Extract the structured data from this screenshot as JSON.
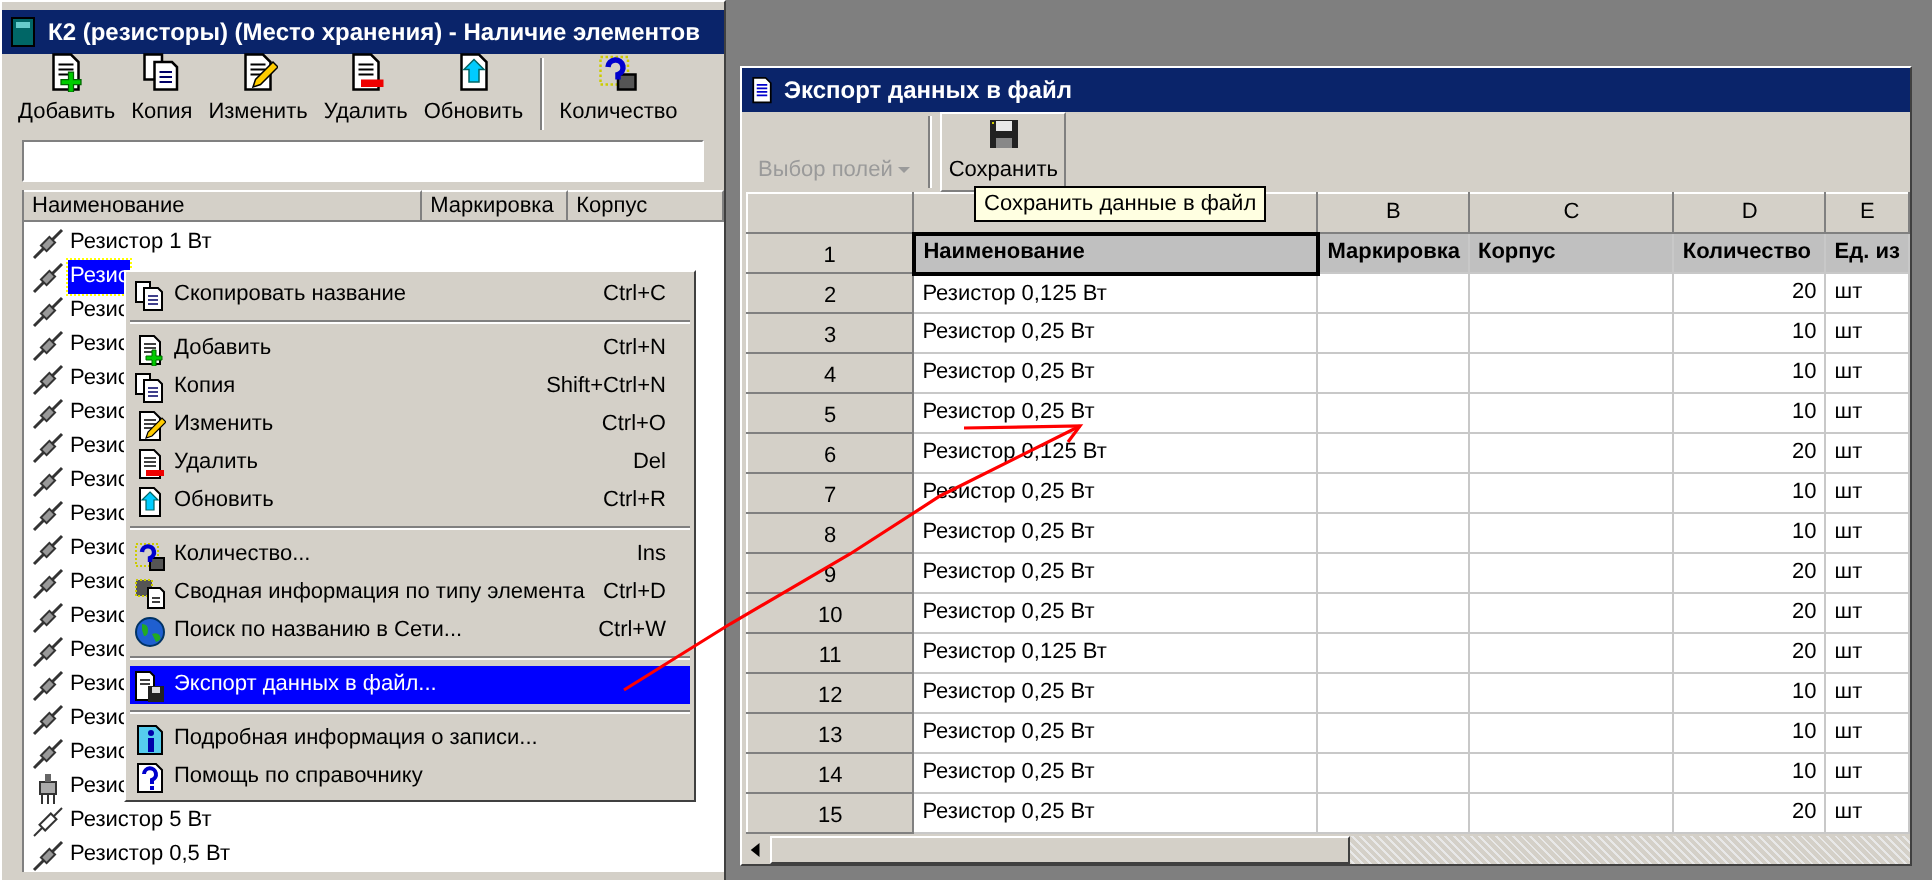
{
  "main_window": {
    "title": "К2 (резисторы) (Место хранения) - Наличие элементов",
    "toolbar": [
      {
        "label": "Добавить"
      },
      {
        "label": "Копия"
      },
      {
        "label": "Изменить"
      },
      {
        "label": "Удалить"
      },
      {
        "label": "Обновить"
      },
      {
        "label": "Количество"
      }
    ],
    "columns": [
      "Наименование",
      "Маркировка",
      "Корпус"
    ],
    "items": [
      {
        "name": "Резистор 1 Вт",
        "selected": false,
        "kind": "fixed"
      },
      {
        "name": "Резис",
        "selected": true,
        "kind": "fixed"
      },
      {
        "name": "Резис",
        "selected": false,
        "kind": "fixed"
      },
      {
        "name": "Резис",
        "selected": false,
        "kind": "fixed"
      },
      {
        "name": "Резис",
        "selected": false,
        "kind": "fixed"
      },
      {
        "name": "Резис",
        "selected": false,
        "kind": "fixed"
      },
      {
        "name": "Резис",
        "selected": false,
        "kind": "fixed"
      },
      {
        "name": "Резис",
        "selected": false,
        "kind": "fixed"
      },
      {
        "name": "Резис",
        "selected": false,
        "kind": "fixed"
      },
      {
        "name": "Резис",
        "selected": false,
        "kind": "fixed"
      },
      {
        "name": "Резис",
        "selected": false,
        "kind": "fixed"
      },
      {
        "name": "Резис",
        "selected": false,
        "kind": "fixed"
      },
      {
        "name": "Резис",
        "selected": false,
        "kind": "fixed"
      },
      {
        "name": "Резис",
        "selected": false,
        "kind": "fixed"
      },
      {
        "name": "Резис",
        "selected": false,
        "kind": "fixed"
      },
      {
        "name": "Резис",
        "selected": false,
        "kind": "fixed"
      },
      {
        "name": "Резис",
        "selected": false,
        "kind": "variable"
      },
      {
        "name": "Резистор 5 Вт",
        "selected": false,
        "kind": "outline"
      },
      {
        "name": "Резистор 0,5 Вт",
        "selected": false,
        "kind": "fixed"
      }
    ]
  },
  "context_menu": {
    "groups": [
      [
        {
          "label": "Скопировать название",
          "shortcut": "Ctrl+C",
          "selected": false
        }
      ],
      [
        {
          "label": "Добавить",
          "shortcut": "Ctrl+N",
          "selected": false
        },
        {
          "label": "Копия",
          "shortcut": "Shift+Ctrl+N",
          "selected": false
        },
        {
          "label": "Изменить",
          "shortcut": "Ctrl+O",
          "selected": false
        },
        {
          "label": "Удалить",
          "shortcut": "Del",
          "selected": false
        },
        {
          "label": "Обновить",
          "shortcut": "Ctrl+R",
          "selected": false
        }
      ],
      [
        {
          "label": "Количество...",
          "shortcut": "Ins",
          "selected": false
        },
        {
          "label": "Сводная информация по типу элемента",
          "shortcut": "Ctrl+D",
          "selected": false
        },
        {
          "label": "Поиск по названию в Сети...",
          "shortcut": "Ctrl+W",
          "selected": false
        }
      ],
      [
        {
          "label": "Экспорт данных в файл...",
          "selected": true
        }
      ],
      [
        {
          "label": "Подробная информация о записи...",
          "selected": false
        },
        {
          "label": "Помощь по справочнику",
          "selected": false
        }
      ]
    ]
  },
  "export_window": {
    "title": "Экспорт данных в файл",
    "field_picker": {
      "label": "Выбор полей",
      "disabled": true
    },
    "save_button": {
      "label": "Сохранить"
    },
    "tooltip": "Сохранить данные в файл",
    "column_letters": [
      "B",
      "C",
      "D",
      "E"
    ],
    "rows": [
      {
        "number": "1",
        "kind": "header",
        "cells": [
          "Наименование",
          "Маркировка",
          "Корпус",
          "Количество",
          "Ед. из"
        ]
      },
      {
        "number": "2",
        "kind": "data",
        "cells": [
          "Резистор 0,125 Вт",
          "",
          "",
          "20",
          "шт"
        ]
      },
      {
        "number": "3",
        "kind": "data",
        "cells": [
          "Резистор 0,25 Вт",
          "",
          "",
          "10",
          "шт"
        ]
      },
      {
        "number": "4",
        "kind": "data",
        "cells": [
          "Резистор 0,25 Вт",
          "",
          "",
          "10",
          "шт"
        ]
      },
      {
        "number": "5",
        "kind": "data",
        "cells": [
          "Резистор 0,25 Вт",
          "",
          "",
          "10",
          "шт"
        ]
      },
      {
        "number": "6",
        "kind": "data",
        "cells": [
          "Резистор 0,125 Вт",
          "",
          "",
          "20",
          "шт"
        ]
      },
      {
        "number": "7",
        "kind": "data",
        "cells": [
          "Резистор 0,25 Вт",
          "",
          "",
          "10",
          "шт"
        ]
      },
      {
        "number": "8",
        "kind": "data",
        "cells": [
          "Резистор 0,25 Вт",
          "",
          "",
          "10",
          "шт"
        ]
      },
      {
        "number": "9",
        "kind": "data",
        "cells": [
          "Резистор 0,25 Вт",
          "",
          "",
          "20",
          "шт"
        ]
      },
      {
        "number": "10",
        "kind": "data",
        "cells": [
          "Резистор 0,25 Вт",
          "",
          "",
          "20",
          "шт"
        ]
      },
      {
        "number": "11",
        "kind": "data",
        "cells": [
          "Резистор 0,125 Вт",
          "",
          "",
          "20",
          "шт"
        ]
      },
      {
        "number": "12",
        "kind": "data",
        "cells": [
          "Резистор 0,25 Вт",
          "",
          "",
          "10",
          "шт"
        ]
      },
      {
        "number": "13",
        "kind": "data",
        "cells": [
          "Резистор 0,25 Вт",
          "",
          "",
          "10",
          "шт"
        ]
      },
      {
        "number": "14",
        "kind": "data",
        "cells": [
          "Резистор 0,25 Вт",
          "",
          "",
          "10",
          "шт"
        ]
      },
      {
        "number": "15",
        "kind": "data",
        "cells": [
          "Резистор 0,25 Вт",
          "",
          "",
          "20",
          "шт"
        ]
      }
    ]
  }
}
